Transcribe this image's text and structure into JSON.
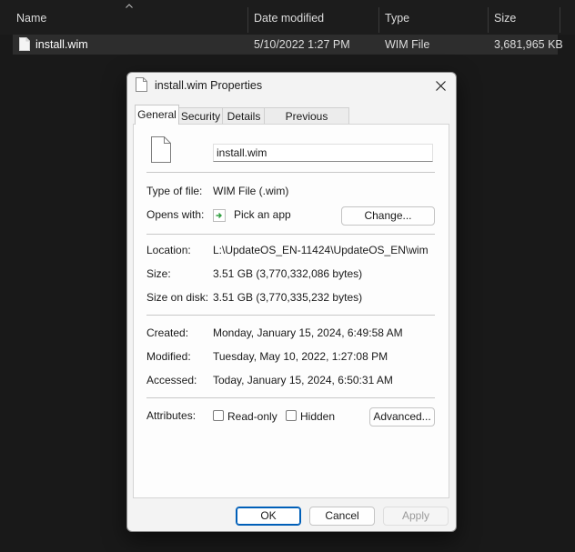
{
  "explorer": {
    "columns": {
      "name": "Name",
      "date_modified": "Date modified",
      "type": "Type",
      "size": "Size"
    },
    "row": {
      "name": "install.wim",
      "date_modified": "5/10/2022 1:27 PM",
      "type": "WIM File",
      "size": "3,681,965 KB"
    }
  },
  "dialog": {
    "title": "install.wim Properties",
    "tabs": [
      "General",
      "Security",
      "Details",
      "Previous Versions"
    ],
    "active_tab": "General",
    "file_name": "install.wim",
    "type_of_file": {
      "label": "Type of file:",
      "value": "WIM File (.wim)"
    },
    "opens_with": {
      "label": "Opens with:",
      "value": "Pick an app",
      "button": "Change..."
    },
    "location": {
      "label": "Location:",
      "value": "L:\\UpdateOS_EN-11424\\UpdateOS_EN\\wim"
    },
    "size": {
      "label": "Size:",
      "value": "3.51 GB (3,770,332,086 bytes)"
    },
    "size_on_disk": {
      "label": "Size on disk:",
      "value": "3.51 GB (3,770,335,232 bytes)"
    },
    "created": {
      "label": "Created:",
      "value": "Monday, January 15, 2024, 6:49:58 AM"
    },
    "modified": {
      "label": "Modified:",
      "value": "Tuesday, May 10, 2022, 1:27:08 PM"
    },
    "accessed": {
      "label": "Accessed:",
      "value": "Today, January 15, 2024, 6:50:31 AM"
    },
    "attributes": {
      "label": "Attributes:",
      "read_only": "Read-only",
      "hidden": "Hidden",
      "advanced": "Advanced..."
    },
    "buttons": {
      "ok": "OK",
      "cancel": "Cancel",
      "apply": "Apply"
    }
  },
  "colors": {
    "accent": "#005fb8",
    "explorer_bg": "#191919",
    "dialog_bg": "#f3f3f3"
  }
}
